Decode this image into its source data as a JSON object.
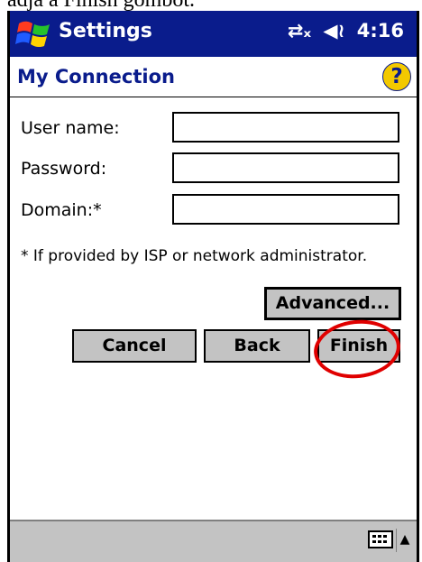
{
  "caption": "adja a Finish gombot.",
  "titlebar": {
    "app_title": "Settings",
    "time": "4:16",
    "icons": [
      "start-flag-icon",
      "connectivity-icon",
      "volume-icon"
    ]
  },
  "header": {
    "title": "My Connection",
    "help_symbol": "?"
  },
  "form": {
    "username_label": "User name:",
    "username_value": "",
    "password_label": "Password:",
    "password_value": "",
    "domain_label": "Domain:*",
    "domain_value": "",
    "note": "* If provided by ISP or network administrator."
  },
  "buttons": {
    "advanced": "Advanced...",
    "cancel": "Cancel",
    "back": "Back",
    "finish": "Finish"
  },
  "colors": {
    "titlebar": "#0a1c8c",
    "button_face": "#c3c3c3",
    "highlight_circle": "#e00000"
  }
}
